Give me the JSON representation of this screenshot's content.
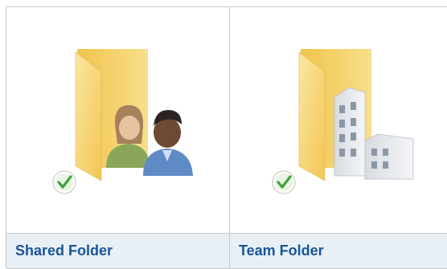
{
  "tiles": [
    {
      "label": "Shared Folder",
      "icon": "shared-folder-icon",
      "status_icon": "checkmark-icon"
    },
    {
      "label": "Team Folder",
      "icon": "team-folder-icon",
      "status_icon": "checkmark-icon"
    }
  ],
  "colors": {
    "label_text": "#1a5597",
    "label_bg": "#e8f0f6",
    "border": "#c8c8c8",
    "folder": "#f7d675",
    "check": "#3fa33a"
  }
}
